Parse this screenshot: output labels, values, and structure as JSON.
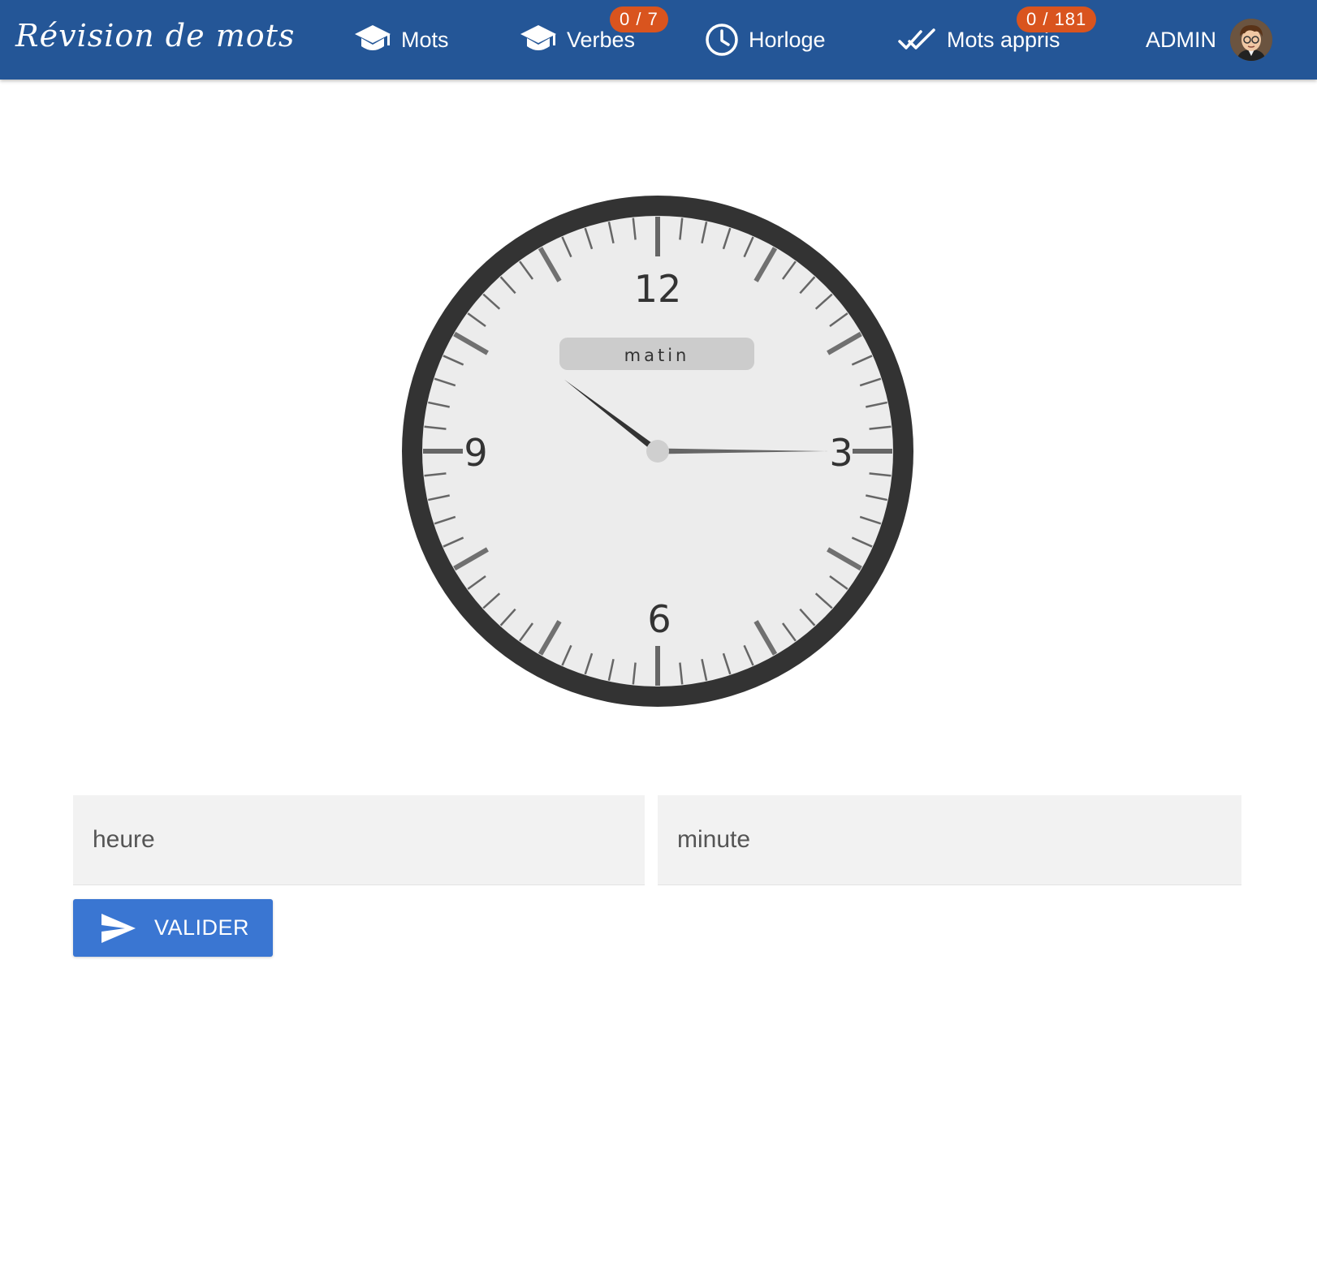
{
  "navbar": {
    "brand": "Révision de mots",
    "items": [
      {
        "label": "Mots",
        "icon": "graduation-cap-icon"
      },
      {
        "label": "Verbes",
        "icon": "graduation-cap-icon",
        "badge": "0 / 7"
      },
      {
        "label": "Horloge",
        "icon": "clock-icon"
      },
      {
        "label": "Mots appris",
        "icon": "double-check-icon",
        "badge": "0 / 181"
      }
    ],
    "user": {
      "label": "ADMIN",
      "icon": "avatar"
    }
  },
  "clock": {
    "numerals": {
      "top": "12",
      "right": "3",
      "bottom": "6",
      "left": "9"
    },
    "period_label": "matin",
    "time": {
      "hour": 10,
      "minute": 15
    }
  },
  "form": {
    "hour_placeholder": "heure",
    "minute_placeholder": "minute",
    "submit_label": "VALIDER",
    "submit_icon": "send-icon"
  },
  "colors": {
    "navbar": "#245697",
    "badge": "#d9541e",
    "button": "#3a76d2",
    "clock_rim": "#333333",
    "clock_face": "#ececec"
  }
}
